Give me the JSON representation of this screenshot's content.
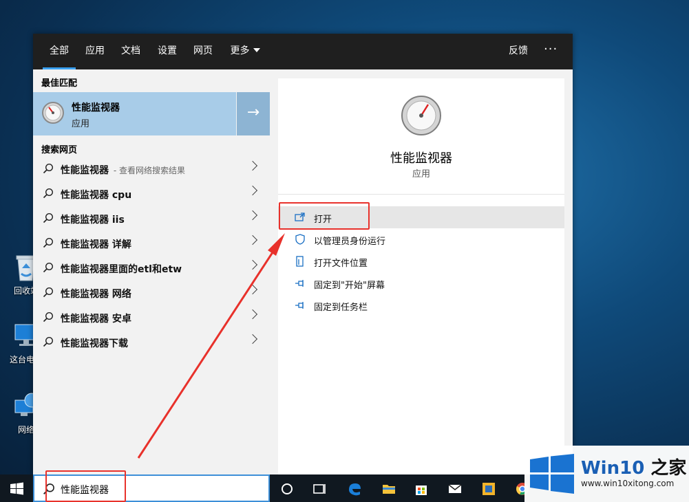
{
  "desktop": {
    "icons": [
      {
        "label": "回收站"
      },
      {
        "label": "这台电脑"
      },
      {
        "label": "网络"
      }
    ]
  },
  "tabs": [
    {
      "label": "全部"
    },
    {
      "label": "应用"
    },
    {
      "label": "文档"
    },
    {
      "label": "设置"
    },
    {
      "label": "网页"
    },
    {
      "label": "更多"
    }
  ],
  "header": {
    "feedback": "反馈",
    "more_menu": "···"
  },
  "best_match": {
    "section_label": "最佳匹配",
    "title": "性能监视器",
    "subtitle": "应用"
  },
  "web_search": {
    "section_label": "搜索网页",
    "items": [
      {
        "text": "性能监视器",
        "hint": "- 查看网络搜索结果"
      },
      {
        "text": "性能监视器 cpu"
      },
      {
        "text": "性能监视器 iis"
      },
      {
        "text": "性能监视器 详解"
      },
      {
        "text": "性能监视器里面的etl和etw"
      },
      {
        "text": "性能监视器 网络"
      },
      {
        "text": "性能监视器 安卓"
      },
      {
        "text": "性能监视器下载"
      }
    ]
  },
  "detail": {
    "title": "性能监视器",
    "subtitle": "应用",
    "actions": [
      {
        "label": "打开",
        "icon": "open-window-icon"
      },
      {
        "label": "以管理员身份运行",
        "icon": "shield-icon"
      },
      {
        "label": "打开文件位置",
        "icon": "file-location-icon"
      },
      {
        "label": "固定到\"开始\"屏幕",
        "icon": "pin-icon"
      },
      {
        "label": "固定到任务栏",
        "icon": "pin-icon"
      }
    ]
  },
  "taskbar": {
    "search_value": "性能监视器",
    "icons": [
      "windows-start-icon",
      "cortana-icon",
      "task-view-icon",
      "edge-icon",
      "file-explorer-icon",
      "store-icon",
      "mail-icon",
      "app-icon",
      "chrome-icon"
    ]
  },
  "watermark": {
    "brand_prefix": "Win10",
    "brand_suffix": "之家",
    "url": "www.win10xitong.com"
  },
  "colors": {
    "accent": "#3aa0f0",
    "best_match_bg": "#a8cce8",
    "annotation": "#e8312b"
  }
}
